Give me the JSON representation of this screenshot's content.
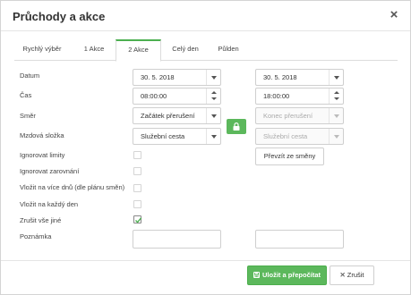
{
  "dialog": {
    "title": "Průchody a akce",
    "close_glyph": "×"
  },
  "tabs": [
    {
      "label": "Rychlý výběr",
      "active": false
    },
    {
      "label": "1 Akce",
      "active": false
    },
    {
      "label": "2 Akce",
      "active": true
    },
    {
      "label": "Celý den",
      "active": false
    },
    {
      "label": "Půlden",
      "active": false
    }
  ],
  "form": {
    "labels": {
      "datum": "Datum",
      "cas": "Čas",
      "smer": "Směr",
      "mzdova": "Mzdová složka",
      "ignorovat_limity": "Ignorovat limity",
      "ignorovat_zarovnani": "Ignorovat zarovnání",
      "vlozit_vice": "Vložit na více dnů (dle plánu směn)",
      "vlozit_kazdy": "Vložit na každý den",
      "zrusit": "Zrušit vše jiné",
      "poznamka": "Poznámka"
    },
    "action1": {
      "datum": "30. 5. 2018",
      "cas": "08:00:00",
      "smer": "Začátek přerušení",
      "mzdova": "Služební cesta",
      "poznamka": ""
    },
    "action2": {
      "datum": "30. 5. 2018",
      "cas": "18:00:00",
      "smer": "Konec přerušení",
      "mzdova": "Služební cesta",
      "poznamka": ""
    },
    "checkboxes": {
      "ignorovat_limity": false,
      "ignorovat_zarovnani": false,
      "vlozit_vice": false,
      "vlozit_kazdy": false,
      "zrusit": true
    },
    "prevzit_label": "Převzít ze směny"
  },
  "buttons": {
    "save_label": "Uložit a přepočítat",
    "cancel_label": "Zrušit"
  },
  "icons": {
    "lock": "lock-icon",
    "save": "floppy-disk-icon",
    "cancel": "x-icon",
    "close": "close-icon"
  },
  "colors": {
    "accent": "#5cb85c",
    "tab_active_border": "#4caf50"
  }
}
